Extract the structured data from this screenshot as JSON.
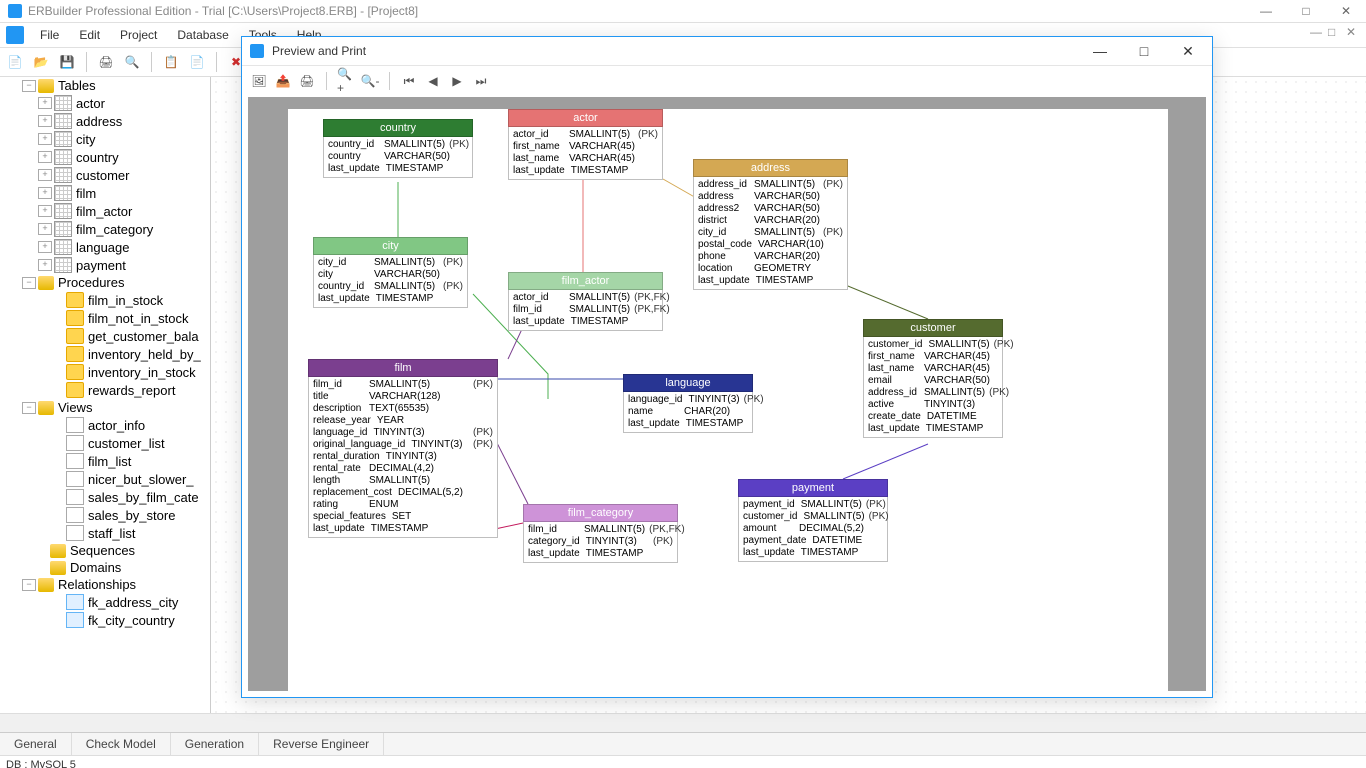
{
  "app": {
    "title": "ERBuilder Professional Edition  - Trial [C:\\Users\\Project8.ERB] - [Project8]"
  },
  "menubar": [
    "File",
    "Edit",
    "Project",
    "Database",
    "Tools",
    "Help"
  ],
  "sidebar": {
    "tables_label": "Tables",
    "tables": [
      "actor",
      "address",
      "city",
      "country",
      "customer",
      "film",
      "film_actor",
      "film_category",
      "language",
      "payment"
    ],
    "procedures_label": "Procedures",
    "procedures": [
      "film_in_stock",
      "film_not_in_stock",
      "get_customer_bala",
      "inventory_held_by_",
      "inventory_in_stock",
      "rewards_report"
    ],
    "views_label": "Views",
    "views": [
      "actor_info",
      "customer_list",
      "film_list",
      "nicer_but_slower_",
      "sales_by_film_cate",
      "sales_by_store",
      "staff_list"
    ],
    "sequences_label": "Sequences",
    "domains_label": "Domains",
    "relationships_label": "Relationships",
    "relationships": [
      "fk_address_city",
      "fk_city_country"
    ]
  },
  "preview": {
    "title": "Preview and Print"
  },
  "tabs": [
    "General",
    "Check Model",
    "Generation",
    "Reverse Engineer"
  ],
  "status": {
    "db": "DB : MySQL 5"
  },
  "entities": {
    "country": {
      "title": "country",
      "columns": [
        {
          "n": "country_id",
          "t": "SMALLINT(5)",
          "k": "(PK)"
        },
        {
          "n": "country",
          "t": "VARCHAR(50)",
          "k": ""
        },
        {
          "n": "last_update",
          "t": "TIMESTAMP",
          "k": ""
        }
      ]
    },
    "actor": {
      "title": "actor",
      "columns": [
        {
          "n": "actor_id",
          "t": "SMALLINT(5)",
          "k": "(PK)"
        },
        {
          "n": "first_name",
          "t": "VARCHAR(45)",
          "k": ""
        },
        {
          "n": "last_name",
          "t": "VARCHAR(45)",
          "k": ""
        },
        {
          "n": "last_update",
          "t": "TIMESTAMP",
          "k": ""
        }
      ]
    },
    "address": {
      "title": "address",
      "columns": [
        {
          "n": "address_id",
          "t": "SMALLINT(5)",
          "k": "(PK)"
        },
        {
          "n": "address",
          "t": "VARCHAR(50)",
          "k": ""
        },
        {
          "n": "address2",
          "t": "VARCHAR(50)",
          "k": ""
        },
        {
          "n": "district",
          "t": "VARCHAR(20)",
          "k": ""
        },
        {
          "n": "city_id",
          "t": "SMALLINT(5)",
          "k": "(PK)"
        },
        {
          "n": "postal_code",
          "t": "VARCHAR(10)",
          "k": ""
        },
        {
          "n": "phone",
          "t": "VARCHAR(20)",
          "k": ""
        },
        {
          "n": "location",
          "t": "GEOMETRY",
          "k": ""
        },
        {
          "n": "last_update",
          "t": "TIMESTAMP",
          "k": ""
        }
      ]
    },
    "city": {
      "title": "city",
      "columns": [
        {
          "n": "city_id",
          "t": "SMALLINT(5)",
          "k": "(PK)"
        },
        {
          "n": "city",
          "t": "VARCHAR(50)",
          "k": ""
        },
        {
          "n": "country_id",
          "t": "SMALLINT(5)",
          "k": "(PK)"
        },
        {
          "n": "last_update",
          "t": "TIMESTAMP",
          "k": ""
        }
      ]
    },
    "film_actor": {
      "title": "film_actor",
      "columns": [
        {
          "n": "actor_id",
          "t": "SMALLINT(5)",
          "k": "(PK,FK)"
        },
        {
          "n": "film_id",
          "t": "SMALLINT(5)",
          "k": "(PK,FK)"
        },
        {
          "n": "last_update",
          "t": "TIMESTAMP",
          "k": ""
        }
      ]
    },
    "customer": {
      "title": "customer",
      "columns": [
        {
          "n": "customer_id",
          "t": "SMALLINT(5)",
          "k": "(PK)"
        },
        {
          "n": "first_name",
          "t": "VARCHAR(45)",
          "k": ""
        },
        {
          "n": "last_name",
          "t": "VARCHAR(45)",
          "k": ""
        },
        {
          "n": "email",
          "t": "VARCHAR(50)",
          "k": ""
        },
        {
          "n": "address_id",
          "t": "SMALLINT(5)",
          "k": "(PK)"
        },
        {
          "n": "active",
          "t": "TINYINT(3)",
          "k": ""
        },
        {
          "n": "create_date",
          "t": "DATETIME",
          "k": ""
        },
        {
          "n": "last_update",
          "t": "TIMESTAMP",
          "k": ""
        }
      ]
    },
    "film": {
      "title": "film",
      "columns": [
        {
          "n": "film_id",
          "t": "SMALLINT(5)",
          "k": "(PK)"
        },
        {
          "n": "title",
          "t": "VARCHAR(128)",
          "k": ""
        },
        {
          "n": "description",
          "t": "TEXT(65535)",
          "k": ""
        },
        {
          "n": "release_year",
          "t": "YEAR",
          "k": ""
        },
        {
          "n": "language_id",
          "t": "TINYINT(3)",
          "k": "(PK)"
        },
        {
          "n": "original_language_id",
          "t": "TINYINT(3)",
          "k": "(PK)"
        },
        {
          "n": "rental_duration",
          "t": "TINYINT(3)",
          "k": ""
        },
        {
          "n": "rental_rate",
          "t": "DECIMAL(4,2)",
          "k": ""
        },
        {
          "n": "length",
          "t": "SMALLINT(5)",
          "k": ""
        },
        {
          "n": "replacement_cost",
          "t": "DECIMAL(5,2)",
          "k": ""
        },
        {
          "n": "rating",
          "t": "ENUM",
          "k": ""
        },
        {
          "n": "special_features",
          "t": "SET",
          "k": ""
        },
        {
          "n": "last_update",
          "t": "TIMESTAMP",
          "k": ""
        }
      ]
    },
    "language": {
      "title": "language",
      "columns": [
        {
          "n": "language_id",
          "t": "TINYINT(3)",
          "k": "(PK)"
        },
        {
          "n": "name",
          "t": "CHAR(20)",
          "k": ""
        },
        {
          "n": "last_update",
          "t": "TIMESTAMP",
          "k": ""
        }
      ]
    },
    "film_category": {
      "title": "film_category",
      "columns": [
        {
          "n": "film_id",
          "t": "SMALLINT(5)",
          "k": "(PK,FK)"
        },
        {
          "n": "category_id",
          "t": "TINYINT(3)",
          "k": "(PK)"
        },
        {
          "n": "last_update",
          "t": "TIMESTAMP",
          "k": ""
        }
      ]
    },
    "payment": {
      "title": "payment",
      "columns": [
        {
          "n": "payment_id",
          "t": "SMALLINT(5)",
          "k": "(PK)"
        },
        {
          "n": "customer_id",
          "t": "SMALLINT(5)",
          "k": "(PK)"
        },
        {
          "n": "amount",
          "t": "DECIMAL(5,2)",
          "k": ""
        },
        {
          "n": "payment_date",
          "t": "DATETIME",
          "k": ""
        },
        {
          "n": "last_update",
          "t": "TIMESTAMP",
          "k": ""
        }
      ]
    }
  }
}
